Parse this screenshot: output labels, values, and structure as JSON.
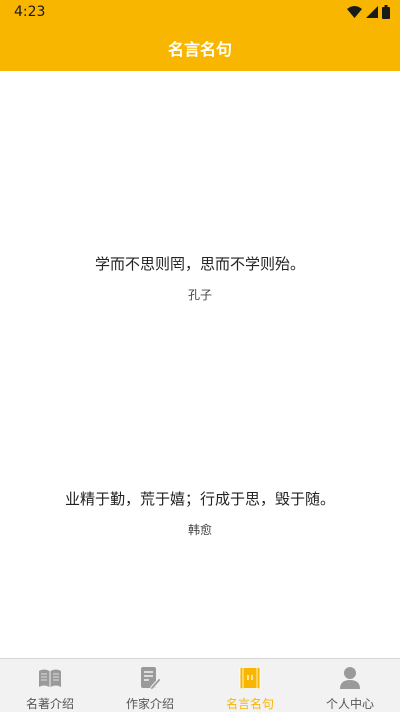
{
  "status_bar": {
    "time": "4:23"
  },
  "app_bar": {
    "title": "名言名句"
  },
  "quotes": [
    {
      "text": "学而不思则罔，思而不学则殆。",
      "author": "孔子"
    },
    {
      "text": "业精于勤，荒于嬉；行成于思，毁于随。",
      "author": "韩愈"
    }
  ],
  "bottom_nav": {
    "items": [
      {
        "label": "名著介绍",
        "icon": "book-icon",
        "active": false
      },
      {
        "label": "作家介绍",
        "icon": "document-edit-icon",
        "active": false
      },
      {
        "label": "名言名句",
        "icon": "scroll-icon",
        "active": true
      },
      {
        "label": "个人中心",
        "icon": "person-icon",
        "active": false
      }
    ]
  },
  "colors": {
    "primary": "#F8B600",
    "inactive_icon": "#9a9a9a",
    "nav_bg": "#f2f2f2"
  }
}
